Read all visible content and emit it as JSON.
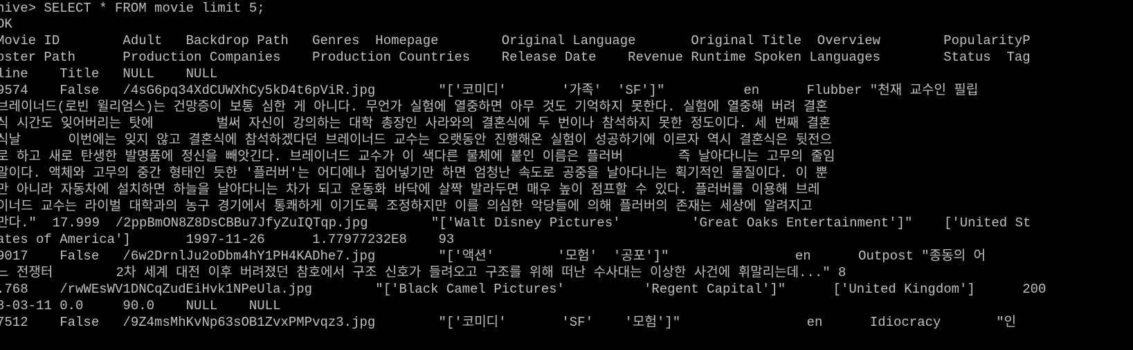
{
  "terminal": {
    "colors": {
      "background": "#000000",
      "foreground": "#c0c0c0"
    },
    "lines": [
      "hive> SELECT * FROM movie limit 5;",
      "OK",
      "Movie ID        Adult   Backdrop Path   Genres  Homepage        Original Language       Original Title  Overview        PopularityP",
      "oster Path      Production Companies    Production Countries    Release Date    Revenue Runtime Spoken Languages        Status  Tag",
      "line    Title   NULL    NULL",
      "9574    False   /4sG6pq34XdCUWXhCy5kD4t6pViR.jpg        \"['코미디'       '가족'  'SF']\"          en      Flubber \"천재 교수인 필립 ",
      "브레이너드(로빈 윌리엄스)는 건망증이 보통 심한 게 아니다. 무언가 실험에 열중하면 아무 것도 기억하지 못한다. 실험에 열중해 버려 결혼",
      "식 시간도 잊어버리는 탓에        벌써 자신이 강의하는 대학 총장인 사라와의 결혼식에 두 번이나 참석하지 못한 정도이다. 세 번째 결혼",
      "식날      이번에는 잊지 않고 결혼식에 참석하겠다던 브레이너드 교수는 오랫동안 진행해온 실험이 성공하기에 이르자 역시 결혼식은 뒷전으",
      "로 하고 새로 탄생한 발명품에 정신을 빼앗긴다. 브레이너드 교수가 이 색다른 물체에 붙인 이름은 플러버       즉 날아다니는 고무의 줄임",
      "말이다. 액체와 고무의 중간 형태인 듯한 '플러버'는 어디에나 집어넣기만 하면 엄청난 속도로 공중을 날아다니는 획기적인 물질이다. 이 뿐",
      "만 아니라 자동차에 설치하면 하늘을 날아다니는 차가 되고 운동화 바닥에 살짝 발라두면 매우 높이 점프할 수 있다. 플러버를 이용해 브레",
      "이너드 교수는 라이벌 대학과의 농구 경기에서 통쾌하게 이기도록 조정하지만 이를 의심한 악당들에 의해 플러버의 존재는 세상에 알려지고 ",
      "만다.\"  17.999  /2ppBmON8Z8DsCBBu7JfyZuIQTqp.jpg        \"['Walt Disney Pictures'         'Great Oaks Entertainment']\"    ['United St",
      "ates of America']       1997-11-26      1.77977232E8    93",
      "9017    False   /6w2DrnlJu2oDbm4hY1PH4KADhe7.jpg        \"['액션'        '모험'  '공포']\"                en      Outpost \"종동의 어",
      "느 전쟁터        2차 세계 대전 이후 버려졌던 참호에서 구조 신호가 들려오고 구조를 위해 떠난 수사대는 이상한 사건에 휘말리는데...\" 8",
      ".768    /rwWEsWV1DNCqZudEiHvk1NPeUla.jpg        \"['Black Camel Pictures'          'Regent Capital']\"      ['United Kingdom']      200",
      "8-03-11 0.0     90.0    NULL    NULL",
      "7512    False   /9Z4msMhKvNp63sOB1ZvxPMPvqz3.jpg        \"['코미디'       'SF'    '모험']\"                en      Idiocracy       \"인"
    ]
  }
}
